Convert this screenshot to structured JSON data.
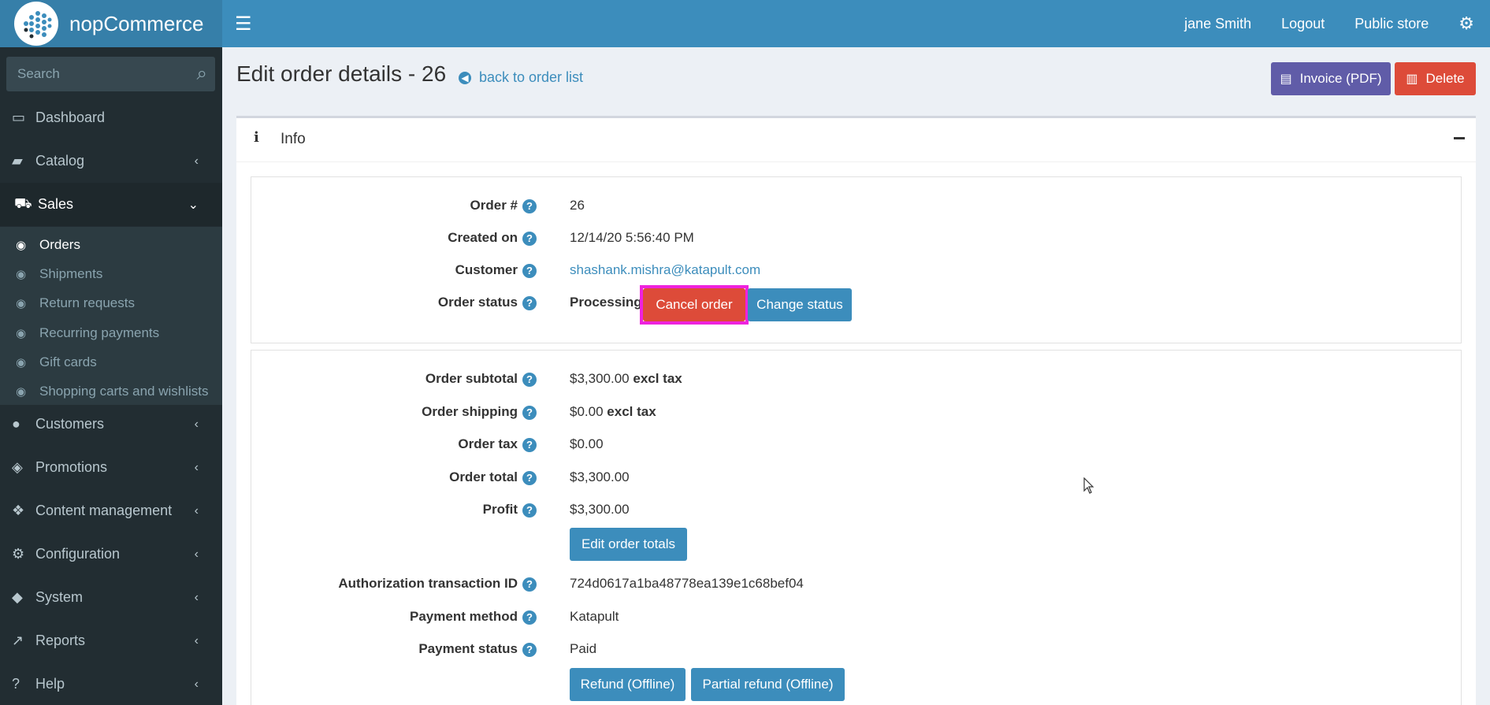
{
  "header": {
    "logo_text": "nopCommerce",
    "menu_icon": "hamburger-icon",
    "user_name": "jane Smith",
    "logout": "Logout",
    "public_store": "Public store",
    "settings_icon": "gear-icon"
  },
  "sidebar": {
    "search_placeholder": "Search",
    "items": [
      {
        "label": "Dashboard",
        "icon": "monitor-icon"
      },
      {
        "label": "Catalog",
        "icon": "book-icon"
      },
      {
        "label": "Sales",
        "icon": "cart-icon"
      },
      {
        "label": "Customers",
        "icon": "user-icon"
      },
      {
        "label": "Promotions",
        "icon": "tags-icon"
      },
      {
        "label": "Content management",
        "icon": "cubes-icon"
      },
      {
        "label": "Configuration",
        "icon": "gears-icon"
      },
      {
        "label": "System",
        "icon": "cube-icon"
      },
      {
        "label": "Reports",
        "icon": "chart-icon"
      },
      {
        "label": "Help",
        "icon": "question-icon"
      }
    ],
    "sales_sub": [
      {
        "label": "Orders"
      },
      {
        "label": "Shipments"
      },
      {
        "label": "Return requests"
      },
      {
        "label": "Recurring payments"
      },
      {
        "label": "Gift cards"
      },
      {
        "label": "Shopping carts and wishlists"
      }
    ]
  },
  "page": {
    "title": "Edit order details - 26",
    "back_link": "back to order list",
    "invoice_button": "Invoice (PDF)",
    "delete_button": "Delete"
  },
  "panel": {
    "title": "Info"
  },
  "order": {
    "order_number_label": "Order #",
    "order_number": "26",
    "created_on_label": "Created on",
    "created_on": "12/14/20 5:56:40 PM",
    "customer_label": "Customer",
    "customer": "shashank.mishra@katapult.com",
    "status_label": "Order status",
    "status": "Processing",
    "cancel_button": "Cancel order",
    "change_status_button": "Change status"
  },
  "totals": {
    "subtotal_label": "Order subtotal",
    "subtotal": "$3,300.00",
    "subtotal_suffix": "excl tax",
    "shipping_label": "Order shipping",
    "shipping": "$0.00",
    "shipping_suffix": "excl tax",
    "tax_label": "Order tax",
    "tax": "$0.00",
    "total_label": "Order total",
    "total": "$3,300.00",
    "profit_label": "Profit",
    "profit": "$3,300.00",
    "edit_totals_button": "Edit order totals",
    "auth_label": "Authorization transaction ID",
    "auth_id": "724d0617a1ba48778ea139e1c68bef04",
    "payment_method_label": "Payment method",
    "payment_method": "Katapult",
    "payment_status_label": "Payment status",
    "payment_status": "Paid",
    "refund_button": "Refund (Offline)",
    "partial_refund_button": "Partial refund (Offline)"
  }
}
